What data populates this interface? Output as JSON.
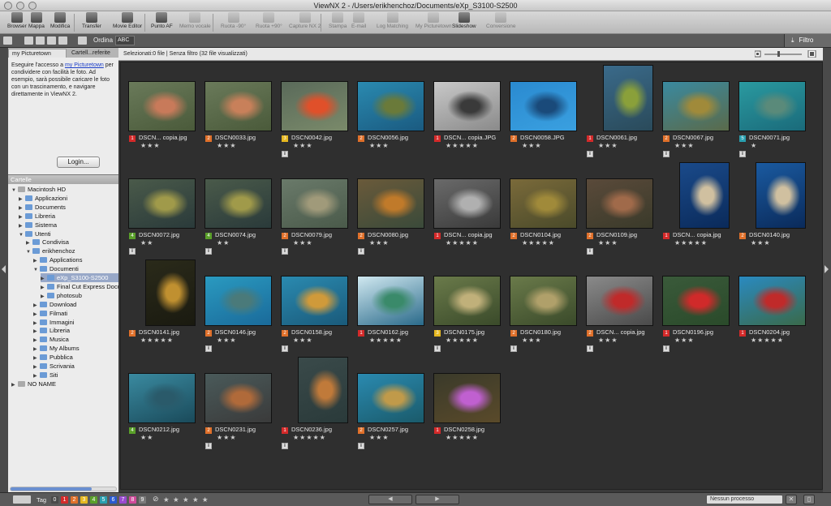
{
  "window": {
    "title": "ViewNX 2 - /Users/erikhenchoz/Documents/eXp_S3100-S2500"
  },
  "toolbar": {
    "items": [
      {
        "label": "Browser",
        "icon": "browser-icon",
        "enabled": true
      },
      {
        "label": "Mappa",
        "icon": "map-icon",
        "enabled": true
      },
      {
        "label": "Modifica",
        "icon": "edit-icon",
        "enabled": true
      },
      {
        "label": "Transfer",
        "icon": "transfer-icon",
        "enabled": true
      },
      {
        "label": "Movie Editor",
        "icon": "movie-editor-icon",
        "enabled": true
      },
      {
        "label": "Punto AF",
        "icon": "af-point-icon",
        "enabled": true
      },
      {
        "label": "Memo vocale",
        "icon": "voice-memo-icon",
        "enabled": false
      },
      {
        "label": "Ruota -90°",
        "icon": "rotate-left-icon",
        "enabled": false
      },
      {
        "label": "Ruota +90°",
        "icon": "rotate-right-icon",
        "enabled": false
      },
      {
        "label": "Capture NX 2",
        "icon": "capture-nx-icon",
        "enabled": false
      },
      {
        "label": "Stampa",
        "icon": "print-icon",
        "enabled": false
      },
      {
        "label": "E-mail",
        "icon": "email-icon",
        "enabled": false
      },
      {
        "label": "Log Matching",
        "icon": "log-matching-icon",
        "enabled": false
      },
      {
        "label": "My Picturetown",
        "icon": "picturetown-icon",
        "enabled": false
      },
      {
        "label": "Slideshow",
        "icon": "slideshow-icon",
        "enabled": true
      },
      {
        "label": "Conversione",
        "icon": "conversion-icon",
        "enabled": false
      }
    ]
  },
  "subbar": {
    "order_label": "Ordina",
    "order_value": "ABC",
    "filter_label": "Filtro"
  },
  "sidebar": {
    "tabs": [
      "my Picturetown",
      "Cartell...referite"
    ],
    "picturetown": {
      "text_before": "Eseguire l'accesso a ",
      "link": "my Picturetown",
      "text_after": " per condividere con facilità le foto. Ad esempio, sarà possibile caricare le foto con un trascinamento, e navigare direttamente in ViewNX 2."
    },
    "login_button": "Login...",
    "folders_header": "Cartelle",
    "tree": [
      {
        "label": "Macintosh HD",
        "level": 0,
        "open": true,
        "type": "drive"
      },
      {
        "label": "Applicazioni",
        "level": 1,
        "open": false
      },
      {
        "label": "Documents",
        "level": 1,
        "open": false
      },
      {
        "label": "Libreria",
        "level": 1,
        "open": false
      },
      {
        "label": "Sistema",
        "level": 1,
        "open": false
      },
      {
        "label": "Utenti",
        "level": 1,
        "open": true
      },
      {
        "label": "Condivisa",
        "level": 2,
        "open": false
      },
      {
        "label": "erikhenchoz",
        "level": 2,
        "open": true,
        "type": "home"
      },
      {
        "label": "Applications",
        "level": 3,
        "open": false
      },
      {
        "label": "Documenti",
        "level": 3,
        "open": true
      },
      {
        "label": "eXp_S3100-S2500",
        "level": 4,
        "open": false,
        "selected": true
      },
      {
        "label": "Final Cut Express Docu",
        "level": 4,
        "open": false
      },
      {
        "label": "photosub",
        "level": 4,
        "open": false
      },
      {
        "label": "Download",
        "level": 3,
        "open": false
      },
      {
        "label": "Filmati",
        "level": 3,
        "open": false
      },
      {
        "label": "Immagini",
        "level": 3,
        "open": false
      },
      {
        "label": "Libreria",
        "level": 3,
        "open": false
      },
      {
        "label": "Musica",
        "level": 3,
        "open": false
      },
      {
        "label": "My Albums",
        "level": 3,
        "open": false
      },
      {
        "label": "Pubblica",
        "level": 3,
        "open": false
      },
      {
        "label": "Scrivania",
        "level": 3,
        "open": false
      },
      {
        "label": "Siti",
        "level": 3,
        "open": false
      },
      {
        "label": "NO NAME",
        "level": 0,
        "open": false,
        "type": "drive"
      }
    ]
  },
  "grid": {
    "status": "Selezionati:0 file | Senza filtro (32 file visualizzati)",
    "label_colors": {
      "1": "#d42a2a",
      "2": "#e0702a",
      "3": "#e6b820",
      "4": "#5aa02a",
      "5": "#2aa0b0"
    },
    "thumbs": [
      {
        "name": "DSCN... copia.jpg",
        "label": 1,
        "stars": 3,
        "info": false,
        "orient": "landscape",
        "colors": [
          "#6a7a5a",
          "#c87a5a",
          "#4a5a3a"
        ]
      },
      {
        "name": "DSCN0033.jpg",
        "label": 2,
        "stars": 3,
        "info": false,
        "orient": "landscape",
        "colors": [
          "#6a7a5a",
          "#c8805a",
          "#4a5a3a"
        ]
      },
      {
        "name": "DSCN0042.jpg",
        "label": 3,
        "stars": 3,
        "info": true,
        "orient": "landscape",
        "colors": [
          "#5a6a5a",
          "#e0502a",
          "#7a8a6a"
        ]
      },
      {
        "name": "DSCN0056.jpg",
        "label": 2,
        "stars": 3,
        "info": false,
        "orient": "landscape",
        "colors": [
          "#2a8ab0",
          "#6a7a3a",
          "#1a5a80"
        ]
      },
      {
        "name": "DSCN... copia.JPG",
        "label": 1,
        "stars": 5,
        "info": false,
        "orient": "landscape",
        "colors": [
          "#c8c8c8",
          "#3a3a3a",
          "#8a8a8a"
        ]
      },
      {
        "name": "DSCN0058.JPG",
        "label": 2,
        "stars": 3,
        "info": false,
        "orient": "landscape",
        "colors": [
          "#2a8ad0",
          "#1a4a7a",
          "#3aa0e0"
        ]
      },
      {
        "name": "DSCN0061.jpg",
        "label": 1,
        "stars": 3,
        "info": true,
        "orient": "portrait",
        "colors": [
          "#3a6a8a",
          "#8aa03a",
          "#2a4a5a"
        ]
      },
      {
        "name": "DSCN0067.jpg",
        "label": 2,
        "stars": 3,
        "info": true,
        "orient": "landscape",
        "colors": [
          "#3a8aa0",
          "#a08a3a",
          "#5a6a4a"
        ]
      },
      {
        "name": "DSCN0071.jpg",
        "label": 5,
        "stars": 1,
        "info": true,
        "orient": "landscape",
        "colors": [
          "#2a9aa0",
          "#5a8a7a",
          "#1a6a7a"
        ]
      },
      {
        "name": "DSCN0072.jpg",
        "label": 4,
        "stars": 2,
        "info": true,
        "orient": "landscape",
        "colors": [
          "#4a5a4a",
          "#a09a4a",
          "#2a3a3a"
        ]
      },
      {
        "name": "DSCN0074.jpg",
        "label": 4,
        "stars": 2,
        "info": true,
        "orient": "landscape",
        "colors": [
          "#4a5a4a",
          "#a09a4a",
          "#2a3a3a"
        ]
      },
      {
        "name": "DSCN0079.jpg",
        "label": 2,
        "stars": 3,
        "info": true,
        "orient": "landscape",
        "colors": [
          "#6a7a6a",
          "#a09a7a",
          "#4a5a4a"
        ]
      },
      {
        "name": "DSCN0080.jpg",
        "label": 2,
        "stars": 3,
        "info": true,
        "orient": "landscape",
        "colors": [
          "#6a5a3a",
          "#c07a2a",
          "#3a4a3a"
        ]
      },
      {
        "name": "DSCN... copia.jpg",
        "label": 1,
        "stars": 5,
        "info": false,
        "orient": "landscape",
        "colors": [
          "#6a6a6a",
          "#b0b0b0",
          "#3a3a3a"
        ]
      },
      {
        "name": "DSCN0104.jpg",
        "label": 2,
        "stars": 5,
        "info": false,
        "orient": "landscape",
        "colors": [
          "#7a6a3a",
          "#a08a3a",
          "#4a4a2a"
        ]
      },
      {
        "name": "DSCN0109.jpg",
        "label": 2,
        "stars": 3,
        "info": true,
        "orient": "landscape",
        "colors": [
          "#5a4a3a",
          "#a06a4a",
          "#3a3a2a"
        ]
      },
      {
        "name": "DSCN... copia.jpg",
        "label": 1,
        "stars": 5,
        "info": false,
        "orient": "portrait",
        "colors": [
          "#1a4a8a",
          "#d0c0a0",
          "#0a2a5a"
        ]
      },
      {
        "name": "DSCN0140.jpg",
        "label": 2,
        "stars": 3,
        "info": false,
        "orient": "portrait",
        "colors": [
          "#1a5aa0",
          "#d0c0a0",
          "#0a2a5a"
        ]
      },
      {
        "name": "DSCN0141.jpg",
        "label": 2,
        "stars": 5,
        "info": false,
        "orient": "portrait",
        "colors": [
          "#2a2a1a",
          "#c09030",
          "#1a1a10"
        ]
      },
      {
        "name": "DSCN0146.jpg",
        "label": 2,
        "stars": 3,
        "info": true,
        "orient": "landscape",
        "colors": [
          "#2a9ac0",
          "#4a7a7a",
          "#1a6a9a"
        ]
      },
      {
        "name": "DSCN0158.jpg",
        "label": 2,
        "stars": 3,
        "info": true,
        "orient": "landscape",
        "colors": [
          "#2a8ab0",
          "#d09a3a",
          "#1a5a7a"
        ]
      },
      {
        "name": "DSCN0162.jpg",
        "label": 1,
        "stars": 5,
        "info": false,
        "orient": "landscape",
        "colors": [
          "#d0e8f0",
          "#3a8a6a",
          "#2a6a8a"
        ]
      },
      {
        "name": "DSCN0175.jpg",
        "label": 3,
        "stars": 5,
        "info": true,
        "orient": "landscape",
        "colors": [
          "#6a7a4a",
          "#c0b07a",
          "#3a4a2a"
        ]
      },
      {
        "name": "DSCN0180.jpg",
        "label": 2,
        "stars": 3,
        "info": true,
        "orient": "landscape",
        "colors": [
          "#6a7a4a",
          "#b0a06a",
          "#3a4a2a"
        ]
      },
      {
        "name": "DSCN... copia.jpg",
        "label": 2,
        "stars": 3,
        "info": true,
        "orient": "landscape",
        "colors": [
          "#8a8a8a",
          "#c02a2a",
          "#4a4a4a"
        ]
      },
      {
        "name": "DSCN0196.jpg",
        "label": 1,
        "stars": 3,
        "info": true,
        "orient": "landscape",
        "colors": [
          "#3a5a3a",
          "#d02a2a",
          "#2a4a2a"
        ]
      },
      {
        "name": "DSCN0204.jpg",
        "label": 1,
        "stars": 5,
        "info": false,
        "orient": "landscape",
        "colors": [
          "#2a8ac0",
          "#c02a2a",
          "#3a6a4a"
        ]
      },
      {
        "name": "DSCN0212.jpg",
        "label": 4,
        "stars": 2,
        "info": false,
        "orient": "landscape",
        "colors": [
          "#3a8aa0",
          "#2a5a6a",
          "#1a4a5a"
        ]
      },
      {
        "name": "DSCN0231.jpg",
        "label": 2,
        "stars": 3,
        "info": true,
        "orient": "landscape",
        "colors": [
          "#4a5a5a",
          "#b06a3a",
          "#3a3a3a"
        ]
      },
      {
        "name": "DSCN0236.jpg",
        "label": 1,
        "stars": 5,
        "info": true,
        "orient": "portrait",
        "colors": [
          "#3a4a4a",
          "#c07a3a",
          "#2a3a3a"
        ]
      },
      {
        "name": "DSCN0257.jpg",
        "label": 2,
        "stars": 3,
        "info": true,
        "orient": "landscape",
        "colors": [
          "#2a8ab0",
          "#c09a4a",
          "#1a5a6a"
        ]
      },
      {
        "name": "DSCN0258.jpg",
        "label": 1,
        "stars": 5,
        "info": false,
        "orient": "landscape",
        "colors": [
          "#3a3a2a",
          "#c060d0",
          "#5a4a2a"
        ]
      }
    ]
  },
  "bottombar": {
    "tag_label": "Tag",
    "tags": [
      "0",
      "1",
      "2",
      "3",
      "4",
      "5",
      "6",
      "7",
      "8",
      "9"
    ],
    "tag_colors": [
      "#4a4a4a",
      "#d42a2a",
      "#e0702a",
      "#e6b820",
      "#5aa02a",
      "#2aa0b0",
      "#2a5ad0",
      "#9a4ad0",
      "#d04a9a",
      "#7a7a7a"
    ],
    "stars": "★ ★ ★ ★ ★",
    "prev": "◀",
    "next": "▶",
    "process_value": "Nessun processo"
  }
}
